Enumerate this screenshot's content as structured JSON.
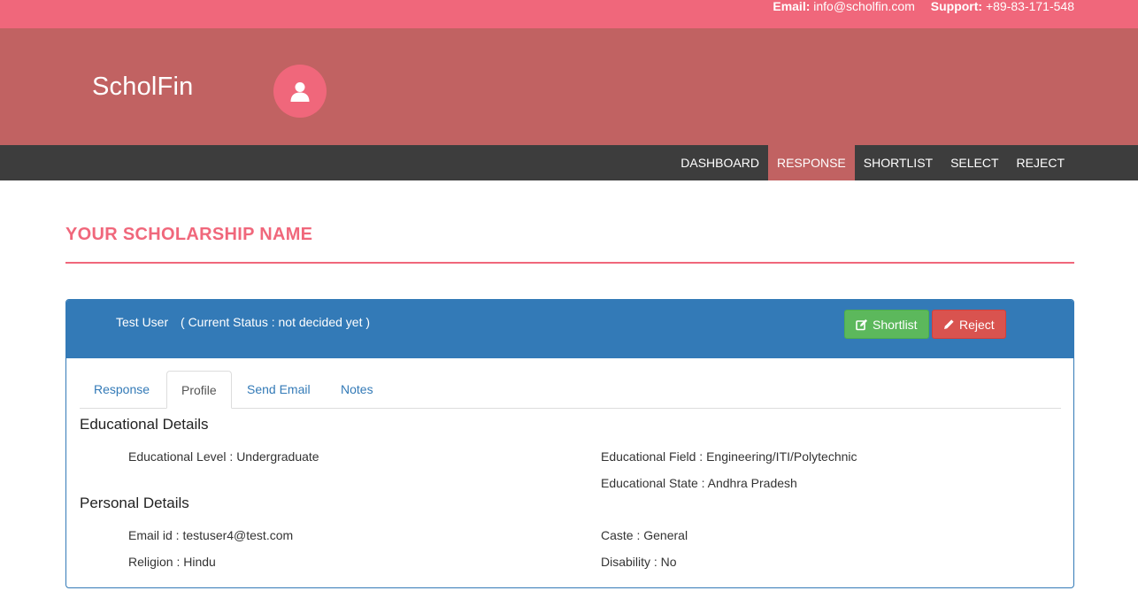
{
  "topbar": {
    "email_label": "Email:",
    "email_value": "info@scholfin.com",
    "support_label": "Support:",
    "support_value": "+89-83-171-548"
  },
  "header": {
    "brand": "ScholFin",
    "avatar_icon": "user-icon"
  },
  "nav": {
    "items": [
      {
        "label": "DASHBOARD",
        "active": false
      },
      {
        "label": "RESPONSE",
        "active": true
      },
      {
        "label": "SHORTLIST",
        "active": false
      },
      {
        "label": "SELECT",
        "active": false
      },
      {
        "label": "REJECT",
        "active": false
      }
    ]
  },
  "page": {
    "title": "YOUR SCHOLARSHIP NAME"
  },
  "panel": {
    "applicant_name": "Test User",
    "status_text": "( Current Status : not decided yet )",
    "shortlist_label": "Shortlist",
    "shortlist_icon": "edit-icon",
    "reject_label": "Reject",
    "reject_icon": "pencil-icon",
    "tabs": [
      {
        "label": "Response",
        "active": false
      },
      {
        "label": "Profile",
        "active": true
      },
      {
        "label": "Send Email",
        "active": false
      },
      {
        "label": "Notes",
        "active": false
      }
    ]
  },
  "profile": {
    "educational_title": "Educational Details",
    "educational_level": "Educational Level : Undergraduate",
    "educational_field": "Educational Field : Engineering/ITI/Polytechnic",
    "educational_state": "Educational State : Andhra Pradesh",
    "personal_title": "Personal Details",
    "email_id": "Email id : testuser4@test.com",
    "caste": "Caste : General",
    "religion": "Religion : Hindu",
    "disability": "Disability : No"
  },
  "colors": {
    "topbar": "#f0677b",
    "header": "#c16262",
    "navbar": "#3d3d3d",
    "accent": "#f0677b",
    "panel_primary": "#337ab7",
    "success": "#5cb85c",
    "danger": "#d9534f"
  }
}
